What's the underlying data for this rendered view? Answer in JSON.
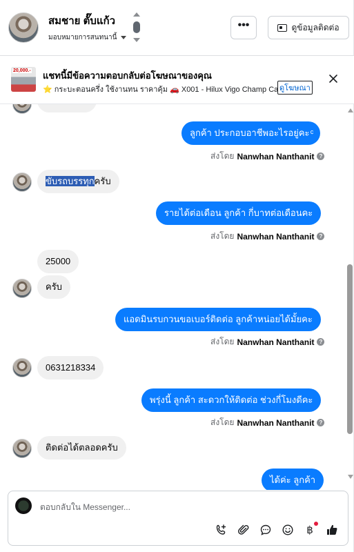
{
  "header": {
    "contact_name": "สมชาย ตั๊บแก้ว",
    "assign_label": "มอบหมายการสนทนานี้",
    "more_label": "•••",
    "contact_info_label": "ดูข้อมูลติดต่อ"
  },
  "ad_banner": {
    "thumb_price": "20,000.-",
    "title": "แชทนี้มีข้อความตอบกลับต่อโฆษณาของคุณ",
    "subtitle": "⭐ กระบะตอนครึ่ง ใช้งานทน ราคาคุ้ม 🚗 X001 - Hilux Vigo Champ Cab...",
    "link_label": "ดูโฆษณา"
  },
  "messages": {
    "out_1": "ลูกค้า ประกอบอาชีพอะไรอยู่คะ ͨ",
    "sent_by_prefix": "ส่งโดย",
    "sent_by_name": "Nanwhan Nanthanit",
    "in_1_selected": "ขับรถบรรทุก",
    "in_1_rest": "ครับ",
    "out_2": "รายได้ต่อเดือน ลูกค้า กี่บาทต่อเดือนคะ",
    "in_2": "25000",
    "in_3": "ครับ",
    "out_3": "แอดมินรบกวนขอเบอร์ติดต่อ ลูกค้าหน่อยได้มั้ยคะ",
    "in_4": "0631218334",
    "out_4": "พรุ่งนี้ ลูกค้า สะดวกให้ติดต่อ ช่วงกี่โมงดีคะ",
    "in_5": "ติดต่อได้ตลอดครับ",
    "out_5_partial": "ได้ค่ะ ลูกค้า"
  },
  "composer": {
    "placeholder": "ตอบกลับใน Messenger..."
  },
  "icons": {
    "call": "phone-plus-icon",
    "attach": "paperclip-icon",
    "saved_replies": "chat-bubble-icon",
    "emoji": "smiley-icon",
    "payment": "baht-icon",
    "like": "thumbs-up-icon"
  },
  "colors": {
    "outgoing_bubble": "#0a7cff",
    "incoming_bubble": "#f0f0f0",
    "selection": "#2d5db4"
  }
}
